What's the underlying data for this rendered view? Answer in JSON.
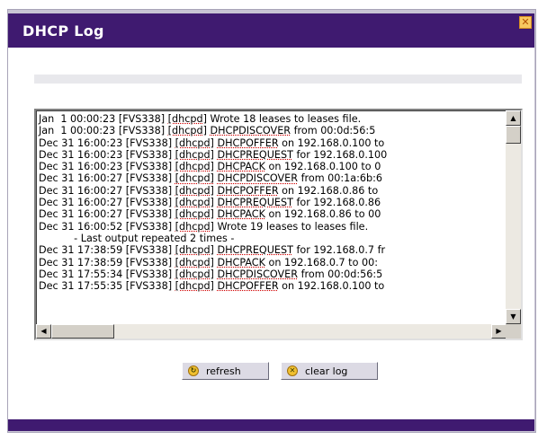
{
  "window": {
    "title": "DHCP Log",
    "close_glyph": "✕"
  },
  "log": {
    "lines": [
      {
        "parts": [
          {
            "t": "Jan  1 00:00:23 [FVS338] "
          },
          {
            "t": "[dhcpd]",
            "u": true
          },
          {
            "t": " Wrote 18 leases to leases file."
          }
        ]
      },
      {
        "parts": [
          {
            "t": "Jan  1 00:00:23 [FVS338] "
          },
          {
            "t": "[dhcpd]",
            "u": true
          },
          {
            "t": " "
          },
          {
            "t": "DHCPDISCOVER",
            "u": true
          },
          {
            "t": " from 00:0d:56:5"
          }
        ]
      },
      {
        "parts": [
          {
            "t": "Dec 31 16:00:23 [FVS338] "
          },
          {
            "t": "[dhcpd]",
            "u": true
          },
          {
            "t": " "
          },
          {
            "t": "DHCPOFFER",
            "u": true
          },
          {
            "t": " on 192.168.0.100 to"
          }
        ]
      },
      {
        "parts": [
          {
            "t": "Dec 31 16:00:23 [FVS338] "
          },
          {
            "t": "[dhcpd]",
            "u": true
          },
          {
            "t": " "
          },
          {
            "t": "DHCPREQUEST",
            "u": true
          },
          {
            "t": " for 192.168.0.100"
          }
        ]
      },
      {
        "parts": [
          {
            "t": "Dec 31 16:00:23 [FVS338] "
          },
          {
            "t": "[dhcpd]",
            "u": true
          },
          {
            "t": " "
          },
          {
            "t": "DHCPACK",
            "u": true
          },
          {
            "t": " on 192.168.0.100 to 0"
          }
        ]
      },
      {
        "parts": [
          {
            "t": "Dec 31 16:00:27 [FVS338] "
          },
          {
            "t": "[dhcpd]",
            "u": true
          },
          {
            "t": " "
          },
          {
            "t": "DHCPDISCOVER",
            "u": true
          },
          {
            "t": " from 00:1a:6b:6"
          }
        ]
      },
      {
        "parts": [
          {
            "t": "Dec 31 16:00:27 [FVS338] "
          },
          {
            "t": "[dhcpd]",
            "u": true
          },
          {
            "t": " "
          },
          {
            "t": "DHCPOFFER",
            "u": true
          },
          {
            "t": " on 192.168.0.86 to"
          }
        ]
      },
      {
        "parts": [
          {
            "t": "Dec 31 16:00:27 [FVS338] "
          },
          {
            "t": "[dhcpd]",
            "u": true
          },
          {
            "t": " "
          },
          {
            "t": "DHCPREQUEST",
            "u": true
          },
          {
            "t": " for 192.168.0.86"
          }
        ]
      },
      {
        "parts": [
          {
            "t": "Dec 31 16:00:27 [FVS338] "
          },
          {
            "t": "[dhcpd]",
            "u": true
          },
          {
            "t": " "
          },
          {
            "t": "DHCPACK",
            "u": true
          },
          {
            "t": " on 192.168.0.86 to 00"
          }
        ]
      },
      {
        "parts": [
          {
            "t": "Dec 31 16:00:52 [FVS338] "
          },
          {
            "t": "[dhcpd]",
            "u": true
          },
          {
            "t": " Wrote 19 leases to leases file."
          }
        ]
      },
      {
        "parts": [
          {
            "t": "           - Last output repeated 2 times -"
          }
        ]
      },
      {
        "parts": [
          {
            "t": "Dec 31 17:38:59 [FVS338] "
          },
          {
            "t": "[dhcpd]",
            "u": true
          },
          {
            "t": " "
          },
          {
            "t": "DHCPREQUEST",
            "u": true
          },
          {
            "t": " for 192.168.0.7 fr"
          }
        ]
      },
      {
        "parts": [
          {
            "t": "Dec 31 17:38:59 [FVS338] "
          },
          {
            "t": "[dhcpd]",
            "u": true
          },
          {
            "t": " "
          },
          {
            "t": "DHCPACK",
            "u": true
          },
          {
            "t": " on 192.168.0.7 to 00:"
          }
        ]
      },
      {
        "parts": [
          {
            "t": "Dec 31 17:55:34 [FVS338] "
          },
          {
            "t": "[dhcpd]",
            "u": true
          },
          {
            "t": " "
          },
          {
            "t": "DHCPDISCOVER",
            "u": true
          },
          {
            "t": " from 00:0d:56:5"
          }
        ]
      },
      {
        "parts": [
          {
            "t": "Dec 31 17:55:35 [FVS338] "
          },
          {
            "t": "[dhcpd]",
            "u": true
          },
          {
            "t": " "
          },
          {
            "t": "DHCPOFFER",
            "u": true
          },
          {
            "t": " on 192.168.0.100 to"
          }
        ]
      }
    ]
  },
  "scrollbar": {
    "up_glyph": "▲",
    "down_glyph": "▼",
    "left_glyph": "◀",
    "right_glyph": "▶"
  },
  "buttons": {
    "refresh": {
      "label": "refresh",
      "icon": "refresh-icon",
      "glyph": "↻"
    },
    "clear_log": {
      "label": "clear log",
      "icon": "clear-icon",
      "glyph": "✕"
    }
  },
  "colors": {
    "title_bar": "#3f1a70",
    "icon_yellow": "#f0c030"
  }
}
